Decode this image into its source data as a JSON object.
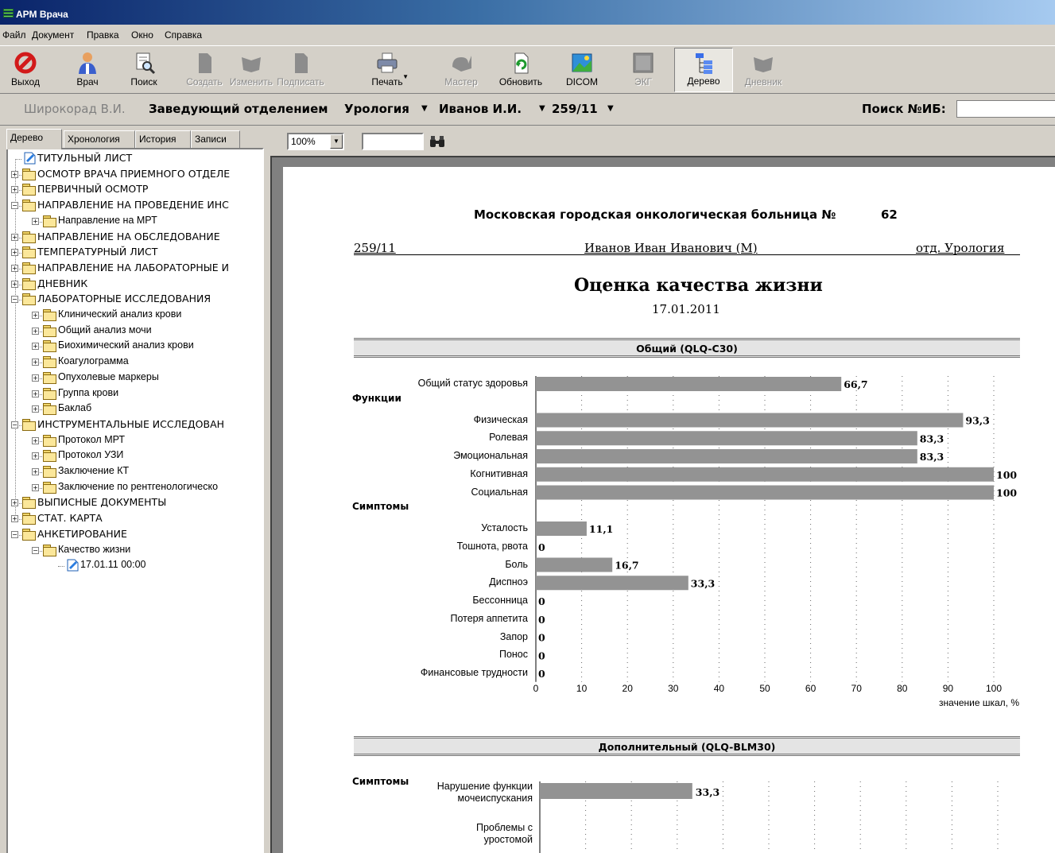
{
  "window": {
    "title": "АРМ Врача"
  },
  "menu": [
    "Файл",
    "Документ",
    "Правка",
    "Окно",
    "Справка"
  ],
  "toolbar": [
    {
      "label": "Выход",
      "icon": "exit-icon",
      "enabled": true
    },
    {
      "label": "Врач",
      "icon": "doctor-icon",
      "enabled": true
    },
    {
      "label": "Поиск",
      "icon": "search-icon",
      "enabled": true
    },
    {
      "label": "Создать",
      "icon": "new-document-icon",
      "enabled": false
    },
    {
      "label": "Изменить",
      "icon": "edit-icon",
      "enabled": false
    },
    {
      "label": "Подписать",
      "icon": "sign-icon",
      "enabled": false
    },
    {
      "label": "Печать",
      "icon": "printer-icon",
      "enabled": true
    },
    {
      "label": "Мастер",
      "icon": "wizard-icon",
      "enabled": false
    },
    {
      "label": "Обновить",
      "icon": "refresh-icon",
      "enabled": true
    },
    {
      "label": "DICOM",
      "icon": "dicom-image-icon",
      "enabled": true
    },
    {
      "label": "ЭКГ",
      "icon": "ecg-icon",
      "enabled": false
    },
    {
      "label": "Дерево",
      "icon": "tree-icon",
      "enabled": true,
      "pressed": true
    },
    {
      "label": "Дневник",
      "icon": "diary-icon",
      "enabled": false
    }
  ],
  "context": {
    "doctor": "Широкорад В.И.",
    "role": "Заведующий отделением",
    "department": "Урология",
    "patient": "Иванов И.И.",
    "case_no": "259/11",
    "search_label": "Поиск №ИБ:",
    "search_value": ""
  },
  "tabs": [
    "Дерево",
    "Хронология",
    "История",
    "Записи"
  ],
  "tree": [
    {
      "label": "ТИТУЛЬНЫЙ ЛИСТ",
      "level": 0,
      "icon": "doc",
      "exp": ""
    },
    {
      "label": "ОСМОТР ВРАЧА ПРИЕМНОГО ОТДЕЛЕ",
      "level": 0,
      "icon": "folder",
      "exp": "+"
    },
    {
      "label": "ПЕРВИЧНЫЙ ОСМОТР",
      "level": 0,
      "icon": "folder",
      "exp": "+"
    },
    {
      "label": "НАПРАВЛЕНИЕ НА ПРОВЕДЕНИЕ ИНС",
      "level": 0,
      "icon": "folder",
      "exp": "−"
    },
    {
      "label": "Направление на МРТ",
      "level": 1,
      "icon": "folder",
      "exp": "+"
    },
    {
      "label": "НАПРАВЛЕНИЕ НА ОБСЛЕДОВАНИЕ",
      "level": 0,
      "icon": "folder",
      "exp": "+"
    },
    {
      "label": "ТЕМПЕРАТУРНЫЙ ЛИСТ",
      "level": 0,
      "icon": "folder",
      "exp": "+"
    },
    {
      "label": "НАПРАВЛЕНИЕ НА ЛАБОРАТОРНЫЕ И",
      "level": 0,
      "icon": "folder",
      "exp": "+"
    },
    {
      "label": "ДНЕВНИК",
      "level": 0,
      "icon": "folder",
      "exp": "+"
    },
    {
      "label": "ЛАБОРАТОРНЫЕ ИССЛЕДОВАНИЯ",
      "level": 0,
      "icon": "folder",
      "exp": "−"
    },
    {
      "label": "Клинический анализ крови",
      "level": 1,
      "icon": "folder",
      "exp": "+"
    },
    {
      "label": "Общий анализ мочи",
      "level": 1,
      "icon": "folder",
      "exp": "+"
    },
    {
      "label": "Биохимический анализ крови",
      "level": 1,
      "icon": "folder",
      "exp": "+"
    },
    {
      "label": "Коагулограмма",
      "level": 1,
      "icon": "folder",
      "exp": "+"
    },
    {
      "label": "Опухолевые маркеры",
      "level": 1,
      "icon": "folder",
      "exp": "+"
    },
    {
      "label": "Группа крови",
      "level": 1,
      "icon": "folder",
      "exp": "+"
    },
    {
      "label": "Баклаб",
      "level": 1,
      "icon": "folder",
      "exp": "+"
    },
    {
      "label": "ИНСТРУМЕНТАЛЬНЫЕ ИССЛЕДОВАН",
      "level": 0,
      "icon": "folder",
      "exp": "−"
    },
    {
      "label": "Протокол МРТ",
      "level": 1,
      "icon": "folder",
      "exp": "+"
    },
    {
      "label": "Протокол УЗИ",
      "level": 1,
      "icon": "folder",
      "exp": "+"
    },
    {
      "label": "Заключение КТ",
      "level": 1,
      "icon": "folder",
      "exp": "+"
    },
    {
      "label": "Заключение по рентгенологическо",
      "level": 1,
      "icon": "folder",
      "exp": "+"
    },
    {
      "label": "ВЫПИСНЫЕ ДОКУМЕНТЫ",
      "level": 0,
      "icon": "folder",
      "exp": "+"
    },
    {
      "label": "СТАТ. КАРТА",
      "level": 0,
      "icon": "folder",
      "exp": "+"
    },
    {
      "label": "АНКЕТИРОВАНИЕ",
      "level": 0,
      "icon": "folder",
      "exp": "−"
    },
    {
      "label": "Качество жизни",
      "level": 1,
      "icon": "folder",
      "exp": "−"
    },
    {
      "label": "17.01.11  00:00",
      "level": 2,
      "icon": "doc",
      "exp": ""
    }
  ],
  "viewer": {
    "zoom": "100%",
    "find_value": ""
  },
  "report": {
    "hospital": "Московская городская онкологическая больница №",
    "hospital_no": "62",
    "case_no": "259/11",
    "patient": "Иванов Иван Иванович (М)",
    "department": "отд. Урология",
    "title": "Оценка качества жизни",
    "date": "17.01.2011",
    "section1": "Общий (QLQ-C30)",
    "section2": "Дополнительный (QLQ-BLM30)"
  },
  "chart_data": [
    {
      "type": "bar",
      "orientation": "horizontal",
      "title": "Общий (QLQ-C30)",
      "xlabel": "значение шкал, %",
      "xlim": [
        0,
        100
      ],
      "xticks": [
        0,
        10,
        20,
        30,
        40,
        50,
        60,
        70,
        80,
        90,
        100
      ],
      "rows": [
        {
          "label": "Общий статус здоровья",
          "value": 66.7,
          "text": "66,7"
        },
        {
          "group": "Функции"
        },
        {
          "label": "Физическая",
          "value": 93.3,
          "text": "93,3"
        },
        {
          "label": "Ролевая",
          "value": 83.3,
          "text": "83,3"
        },
        {
          "label": "Эмоциональная",
          "value": 83.3,
          "text": "83,3"
        },
        {
          "label": "Когнитивная",
          "value": 100,
          "text": "100"
        },
        {
          "label": "Социальная",
          "value": 100,
          "text": "100"
        },
        {
          "group": "Симптомы"
        },
        {
          "label": "Усталость",
          "value": 11.1,
          "text": "11,1"
        },
        {
          "label": "Тошнота, рвота",
          "value": 0,
          "text": "0"
        },
        {
          "label": "Боль",
          "value": 16.7,
          "text": "16,7"
        },
        {
          "label": "Диспноэ",
          "value": 33.3,
          "text": "33,3"
        },
        {
          "label": "Бессонница",
          "value": 0,
          "text": "0"
        },
        {
          "label": "Потеря аппетита",
          "value": 0,
          "text": "0"
        },
        {
          "label": "Запор",
          "value": 0,
          "text": "0"
        },
        {
          "label": "Понос",
          "value": 0,
          "text": "0"
        },
        {
          "label": "Финансовые трудности",
          "value": 0,
          "text": "0"
        }
      ]
    },
    {
      "type": "bar",
      "orientation": "horizontal",
      "title": "Дополнительный (QLQ-BLM30)",
      "xlim": [
        0,
        100
      ],
      "group": "Симптомы",
      "rows": [
        {
          "label": "Нарушение функции мочеиспускания",
          "value": 33.3,
          "text": "33,3"
        },
        {
          "label": "Проблемы с уростомой",
          "value": null,
          "text": ""
        }
      ]
    }
  ]
}
